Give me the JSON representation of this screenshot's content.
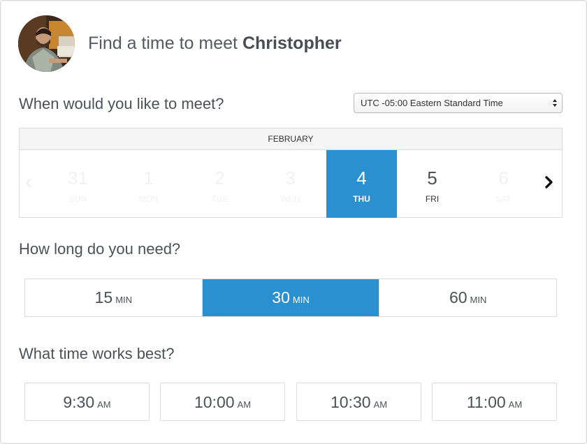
{
  "header": {
    "title_prefix": "Find a time to meet",
    "host_name": "Christopher"
  },
  "when": {
    "heading": "When would you like to meet?",
    "timezone": "UTC -05:00 Eastern Standard Time"
  },
  "calendar": {
    "month": "FEBRUARY",
    "days": [
      {
        "num": "31",
        "weekday": "SUN",
        "state": "disabled"
      },
      {
        "num": "1",
        "weekday": "MON",
        "state": "disabled"
      },
      {
        "num": "2",
        "weekday": "TUE",
        "state": "disabled"
      },
      {
        "num": "3",
        "weekday": "WED",
        "state": "disabled"
      },
      {
        "num": "4",
        "weekday": "THU",
        "state": "selected"
      },
      {
        "num": "5",
        "weekday": "FRI",
        "state": "available"
      },
      {
        "num": "6",
        "weekday": "SAT",
        "state": "disabled"
      }
    ],
    "prev_icon": "chevron-left-icon",
    "next_icon": "chevron-right-icon"
  },
  "duration": {
    "heading": "How long do you need?",
    "options": [
      {
        "value": "15",
        "unit": "MIN",
        "selected": false
      },
      {
        "value": "30",
        "unit": "MIN",
        "selected": true
      },
      {
        "value": "60",
        "unit": "MIN",
        "selected": false
      }
    ]
  },
  "times": {
    "heading": "What time works best?",
    "slots": [
      {
        "time": "9:30",
        "period": "AM"
      },
      {
        "time": "10:00",
        "period": "AM"
      },
      {
        "time": "10:30",
        "period": "AM"
      },
      {
        "time": "11:00",
        "period": "AM"
      }
    ]
  },
  "colors": {
    "accent": "#2b90cf",
    "text": "#4d5157",
    "border": "#dcdcdc"
  }
}
